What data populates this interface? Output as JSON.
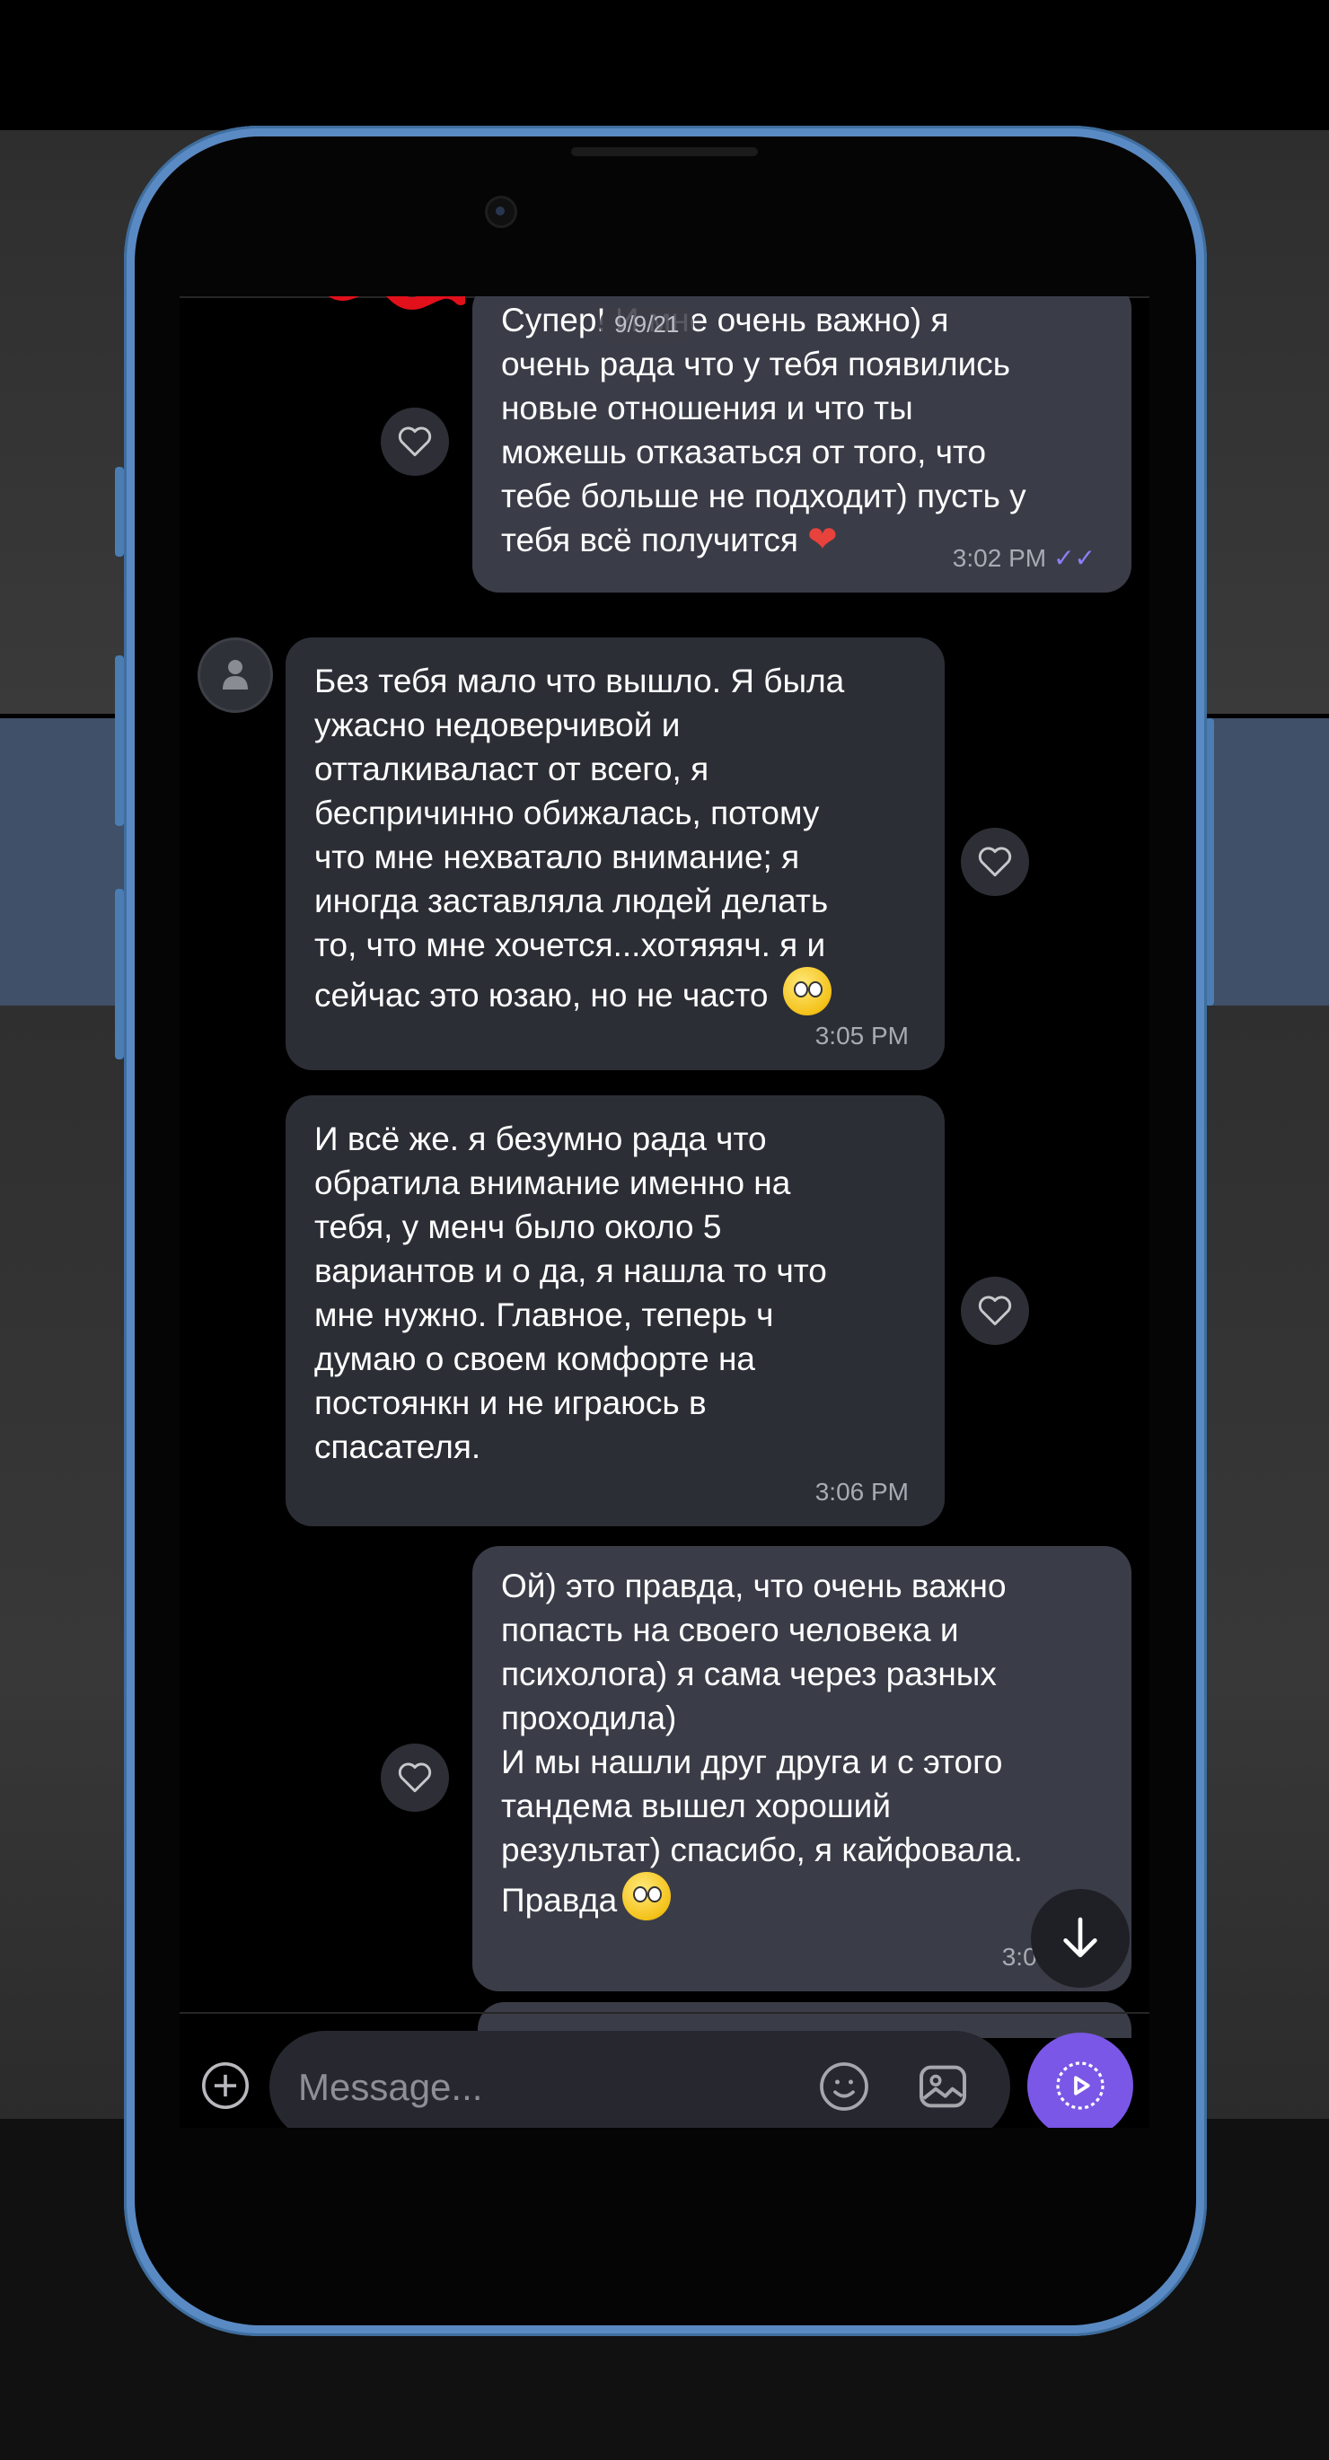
{
  "chat": {
    "date": "9/9/21",
    "messages": [
      {
        "direction": "outgoing",
        "text_lines": [
          "Супер! И мне очень важно) я",
          "очень рада что у тебя появились",
          "новые отношения и что ты",
          "можешь отказаться от того, что",
          "тебе больше не подходит) пусть у",
          "тебя всё получится"
        ],
        "emoji": "red-heart-emoji",
        "time": "3:02 PM",
        "status": "read"
      },
      {
        "direction": "incoming",
        "text_lines": [
          "Без тебя мало что вышло. Я была",
          "ужасно недоверчивой и",
          "отталкиваласт от всего, я",
          "беспричинно обижалась, потому",
          "что мне нехватало внимание; я",
          "иногда заставляла людей делать",
          "то, что мне хочется...хотяяяч. я и",
          "сейчас это юзаю, но не часто"
        ],
        "emoji": "smiling-face-emoji",
        "time": "3:05 PM"
      },
      {
        "direction": "incoming",
        "text_lines": [
          "И всё же. я безумно рада что",
          "обратила внимание именно на",
          "тебя, у менч было около 5",
          "вариантов и о да, я нашла то что",
          "мне нужно. Главное, теперь ч",
          "думаю о своем комфорте на",
          "постоянкн и не играюсь в",
          "спасателя."
        ],
        "time": "3:06 PM"
      },
      {
        "direction": "outgoing",
        "text_lines": [
          "Ой) это правда, что очень важно",
          "попасть на своего человека и",
          "психолога) я сама через разных",
          "проходила)",
          "И мы нашли друг друга и с этого",
          "тандема вышел хороший",
          "результат) спасибо, я кайфовала.",
          "Правда"
        ],
        "emoji": "smiling-face-emoji",
        "time": "3:09 PM"
      }
    ]
  },
  "composer": {
    "placeholder": "Message..."
  },
  "colors": {
    "accent": "#7a57e6",
    "outgoing_bubble": "#3a3d48",
    "incoming_bubble": "#2c2e36",
    "read_ticks": "#8b80f5"
  },
  "icons": {
    "like": "heart-outline-icon",
    "scroll": "arrow-down-icon",
    "attach": "plus-circle-icon",
    "emoji": "smiley-icon",
    "gallery": "image-icon",
    "send": "play-circle-icon"
  }
}
